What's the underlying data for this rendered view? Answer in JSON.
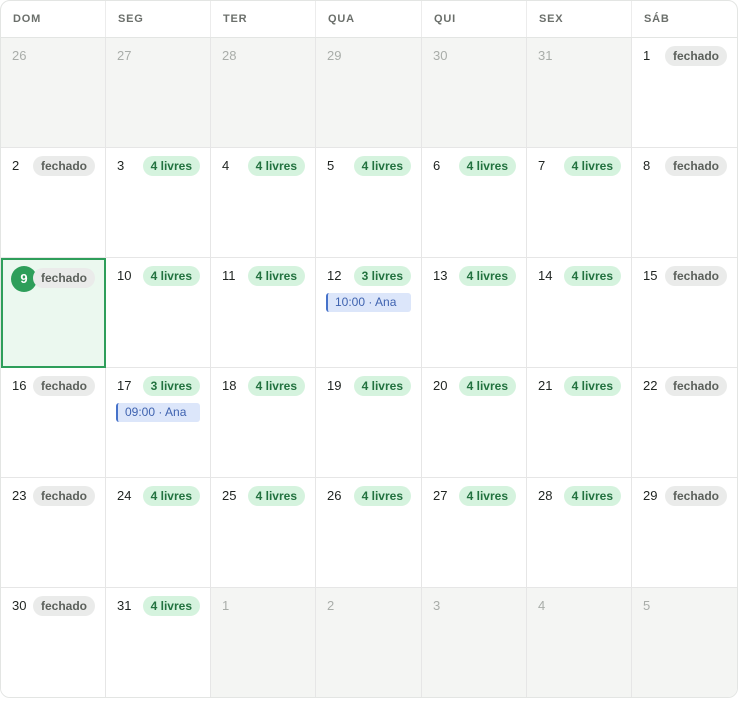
{
  "weekdays": [
    "DOM",
    "SEG",
    "TER",
    "QUA",
    "QUI",
    "SEX",
    "SÁB"
  ],
  "colors": {
    "today": "#2e9e5a",
    "free_badge_bg": "#d5f3de",
    "free_badge_text": "#22723f",
    "closed_badge_bg": "#eaebea",
    "event_bg": "#dce6fa",
    "event_border": "#4672c9"
  },
  "days": [
    {
      "day": "26",
      "out": true
    },
    {
      "day": "27",
      "out": true
    },
    {
      "day": "28",
      "out": true
    },
    {
      "day": "29",
      "out": true
    },
    {
      "day": "30",
      "out": true
    },
    {
      "day": "31",
      "out": true
    },
    {
      "day": "1",
      "badge": "fechado",
      "type": "closed"
    },
    {
      "day": "2",
      "badge": "fechado",
      "type": "closed"
    },
    {
      "day": "3",
      "badge": "4 livres",
      "type": "free"
    },
    {
      "day": "4",
      "badge": "4 livres",
      "type": "free"
    },
    {
      "day": "5",
      "badge": "4 livres",
      "type": "free"
    },
    {
      "day": "6",
      "badge": "4 livres",
      "type": "free"
    },
    {
      "day": "7",
      "badge": "4 livres",
      "type": "free"
    },
    {
      "day": "8",
      "badge": "fechado",
      "type": "closed"
    },
    {
      "day": "9",
      "badge": "fechado",
      "type": "closed",
      "today": true
    },
    {
      "day": "10",
      "badge": "4 livres",
      "type": "free"
    },
    {
      "day": "11",
      "badge": "4 livres",
      "type": "free"
    },
    {
      "day": "12",
      "badge": "3 livres",
      "type": "free",
      "event": "10:00 · Ana"
    },
    {
      "day": "13",
      "badge": "4 livres",
      "type": "free"
    },
    {
      "day": "14",
      "badge": "4 livres",
      "type": "free"
    },
    {
      "day": "15",
      "badge": "fechado",
      "type": "closed"
    },
    {
      "day": "16",
      "badge": "fechado",
      "type": "closed"
    },
    {
      "day": "17",
      "badge": "3 livres",
      "type": "free",
      "event": "09:00 · Ana"
    },
    {
      "day": "18",
      "badge": "4 livres",
      "type": "free"
    },
    {
      "day": "19",
      "badge": "4 livres",
      "type": "free"
    },
    {
      "day": "20",
      "badge": "4 livres",
      "type": "free"
    },
    {
      "day": "21",
      "badge": "4 livres",
      "type": "free"
    },
    {
      "day": "22",
      "badge": "fechado",
      "type": "closed"
    },
    {
      "day": "23",
      "badge": "fechado",
      "type": "closed"
    },
    {
      "day": "24",
      "badge": "4 livres",
      "type": "free"
    },
    {
      "day": "25",
      "badge": "4 livres",
      "type": "free"
    },
    {
      "day": "26",
      "badge": "4 livres",
      "type": "free"
    },
    {
      "day": "27",
      "badge": "4 livres",
      "type": "free"
    },
    {
      "day": "28",
      "badge": "4 livres",
      "type": "free"
    },
    {
      "day": "29",
      "badge": "fechado",
      "type": "closed"
    },
    {
      "day": "30",
      "badge": "fechado",
      "type": "closed"
    },
    {
      "day": "31",
      "badge": "4 livres",
      "type": "free"
    },
    {
      "day": "1",
      "out": true
    },
    {
      "day": "2",
      "out": true
    },
    {
      "day": "3",
      "out": true
    },
    {
      "day": "4",
      "out": true
    },
    {
      "day": "5",
      "out": true
    }
  ]
}
